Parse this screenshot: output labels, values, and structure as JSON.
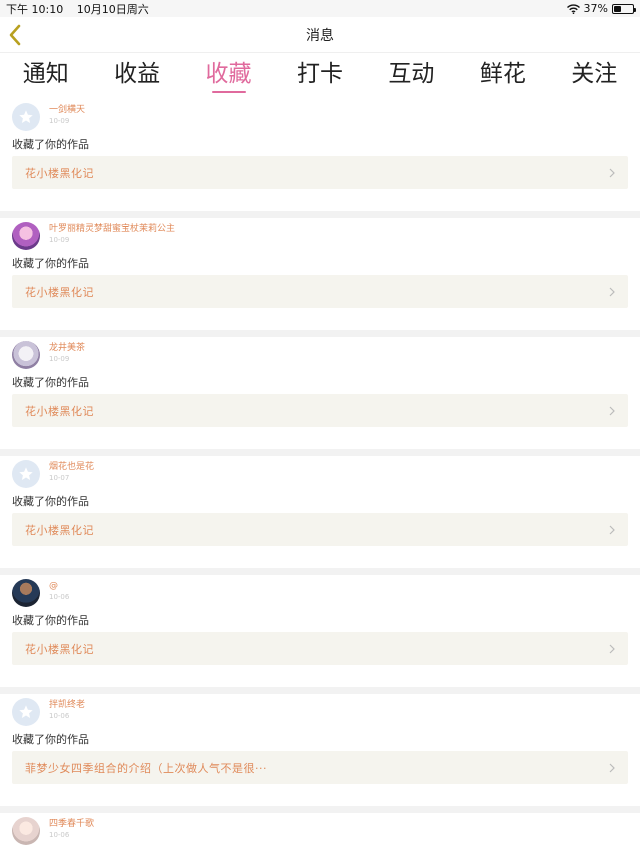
{
  "status": {
    "time": "下午 10:10",
    "date": "10月10日周六",
    "battery": "37%",
    "battery_level": 0.37
  },
  "nav": {
    "title": "消息"
  },
  "tabs": [
    {
      "label": "通知",
      "active": false
    },
    {
      "label": "收益",
      "active": false
    },
    {
      "label": "收藏",
      "active": true
    },
    {
      "label": "打卡",
      "active": false
    },
    {
      "label": "互动",
      "active": false
    },
    {
      "label": "鲜花",
      "active": false
    },
    {
      "label": "关注",
      "active": false
    }
  ],
  "items": [
    {
      "user": "一剑横天",
      "date": "10-09",
      "action": "收藏了你的作品",
      "work": "花小楼黑化记",
      "avatar": "default"
    },
    {
      "user": "叶罗丽精灵梦甜蜜宝杖茉莉公主",
      "date": "10-09",
      "action": "收藏了你的作品",
      "work": "花小楼黑化记",
      "avatar": "img1"
    },
    {
      "user": "龙井美茶",
      "date": "10-09",
      "action": "收藏了你的作品",
      "work": "花小楼黑化记",
      "avatar": "img2"
    },
    {
      "user": "烟花也是花",
      "date": "10-07",
      "action": "收藏了你的作品",
      "work": "花小楼黑化记",
      "avatar": "default"
    },
    {
      "user": "@",
      "date": "10-06",
      "action": "收藏了你的作品",
      "work": "花小楼黑化记",
      "avatar": "img3"
    },
    {
      "user": "拌凯终老",
      "date": "10-06",
      "action": "收藏了你的作品",
      "work": "菲梦少女四季组合的介绍（上次做人气不是很···",
      "avatar": "default"
    },
    {
      "user": "四季春千歌",
      "date": "10-06",
      "action": "",
      "work": "",
      "avatar": "img4"
    }
  ],
  "colors": {
    "accent": "#e06a9d",
    "username": "#e08a5a",
    "work_bg": "#f5f4ee"
  }
}
